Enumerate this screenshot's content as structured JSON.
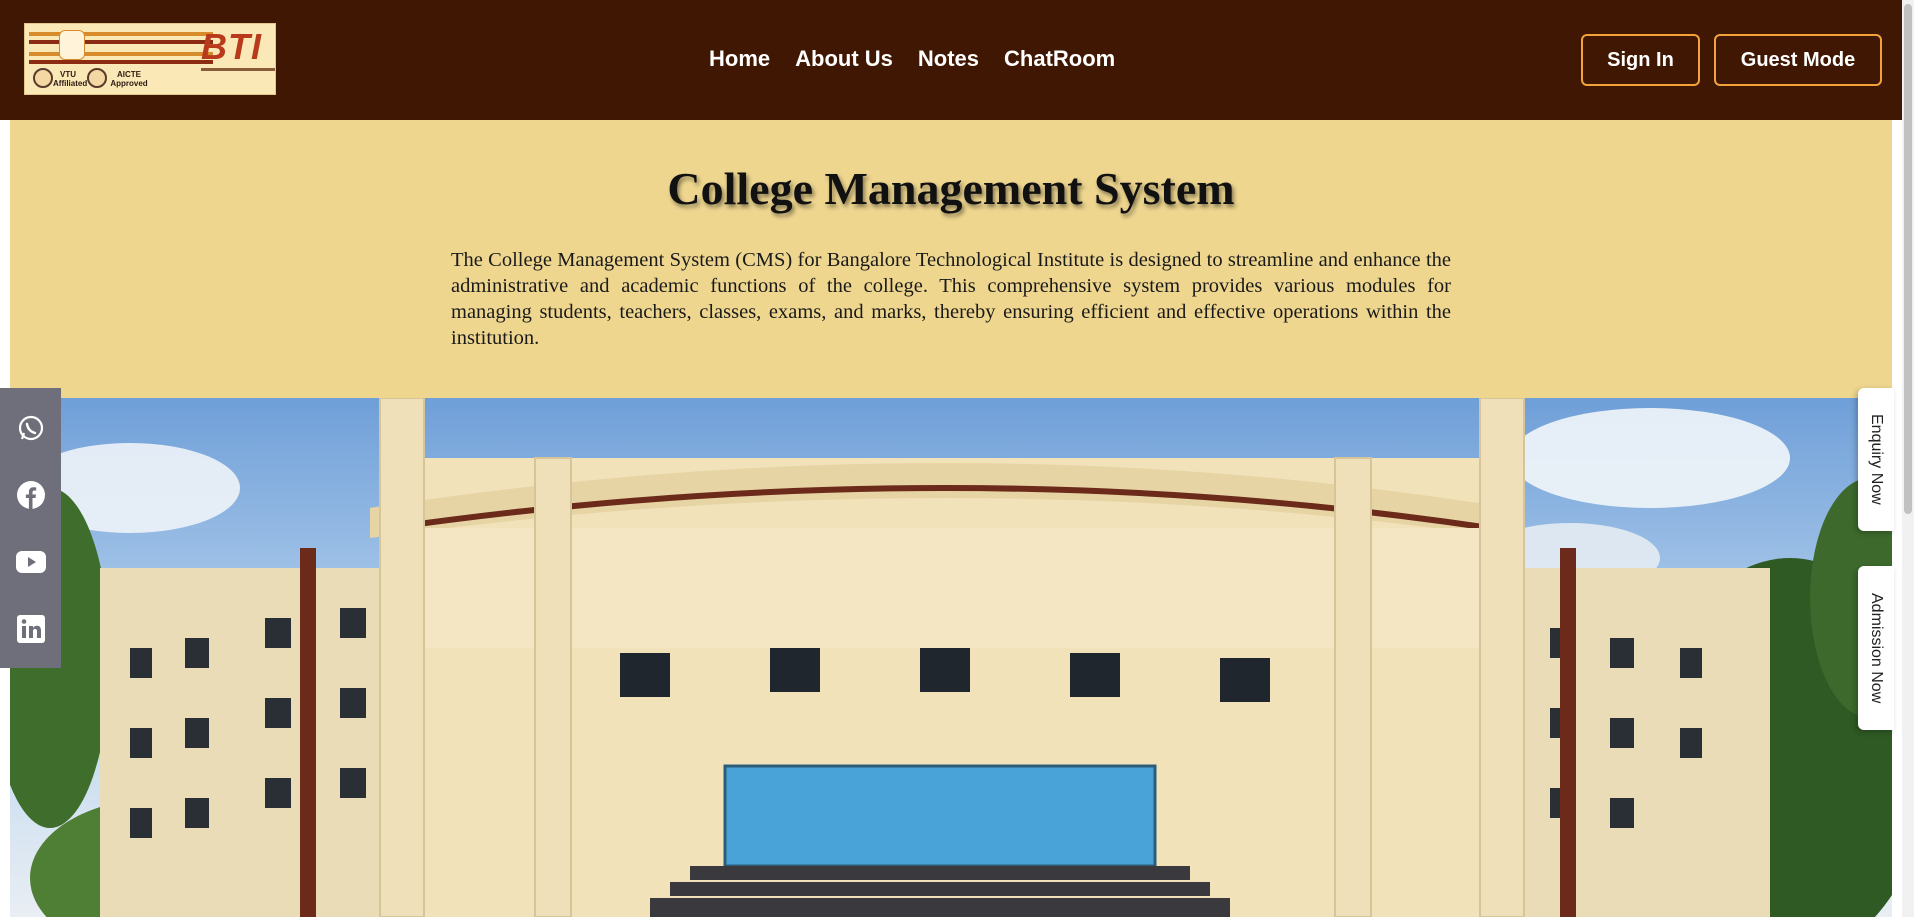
{
  "header": {
    "logo": {
      "brand_text": "BTI",
      "seal1_caption": "VTU Affiliated",
      "seal2_caption": "AICTE Approved"
    },
    "nav": [
      {
        "label": "Home"
      },
      {
        "label": "About Us"
      },
      {
        "label": "Notes"
      },
      {
        "label": "ChatRoom"
      }
    ],
    "sign_in_label": "Sign In",
    "guest_mode_label": "Guest Mode",
    "background_color": "#3f1702",
    "button_border_color": "#f3a33a"
  },
  "intro": {
    "title": "College Management System",
    "description": "The College Management System (CMS) for Bangalore Technological Institute is designed to streamline and enhance the administrative and academic functions of the college. This comprehensive system provides various modules for managing students, teachers, classes, exams, and marks, thereby ensuring efficient and effective operations within the institution.",
    "background_color": "#eed68f"
  },
  "social": {
    "icons": [
      "whatsapp-icon",
      "facebook-icon",
      "youtube-icon",
      "linkedin-icon"
    ]
  },
  "side_tabs": {
    "enquiry_label": "Enquiry Now",
    "admission_label": "Admission Now"
  }
}
